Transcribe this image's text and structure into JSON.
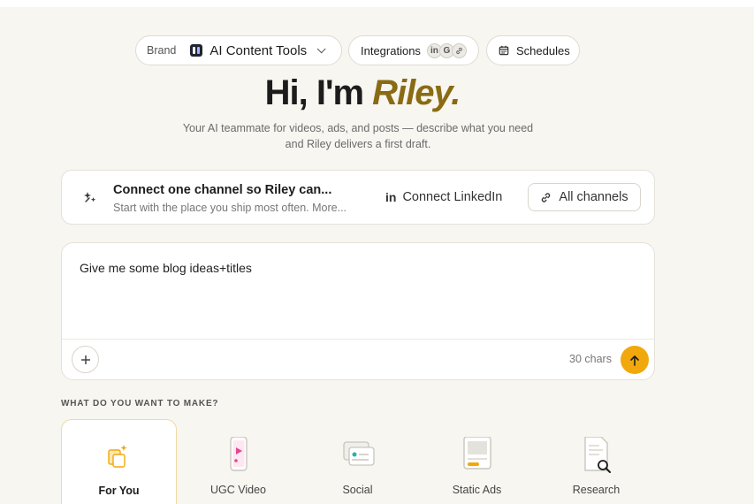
{
  "header": {
    "brand_label": "Brand",
    "brand_name": "AI Content Tools",
    "integrations_label": "Integrations",
    "integration_icons": [
      "in",
      "G",
      "link"
    ],
    "schedules_label": "Schedules"
  },
  "hero": {
    "greeting": "Hi, I'm ",
    "name": "Riley.",
    "subtitle": "Your AI teammate for videos, ads, and posts — describe what you need and Riley delivers a first draft."
  },
  "connect_card": {
    "title": "Connect one channel so Riley can...",
    "subtitle": "Start with the place you ship most often. More...",
    "linkedin_label": "Connect LinkedIn",
    "all_channels_label": "All channels"
  },
  "composer": {
    "value": "Give me some blog ideas+titles",
    "char_count": "30 chars"
  },
  "make_section": {
    "label": "WHAT DO YOU WANT TO MAKE?",
    "tiles": [
      {
        "label": "For You",
        "icon": "sparkle-cards-icon",
        "selected": true
      },
      {
        "label": "UGC Video",
        "icon": "phone-video-icon",
        "selected": false
      },
      {
        "label": "Social",
        "icon": "social-post-icon",
        "selected": false
      },
      {
        "label": "Static Ads",
        "icon": "static-ad-icon",
        "selected": false
      },
      {
        "label": "Research",
        "icon": "document-search-icon",
        "selected": false
      }
    ]
  },
  "colors": {
    "background": "#f7f6f1",
    "accent_name": "#8a6b14",
    "send_button": "#f1a80c",
    "selected_tile_border": "#f0d9a4"
  }
}
